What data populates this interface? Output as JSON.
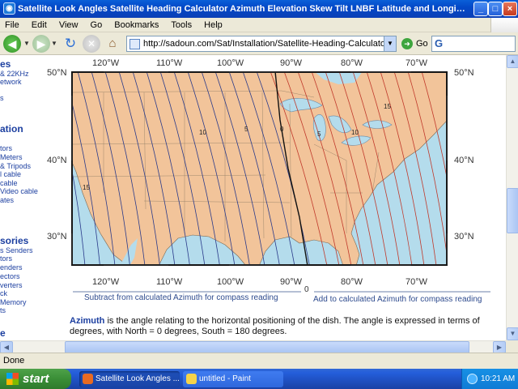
{
  "window": {
    "title": "Satellite Look Angles Satellite Heading Calculator Azimuth Elevation Skew Tilt LNBF Latitude and Longitude valu...",
    "buttons": {
      "minimize": "_",
      "maximize": "□",
      "close": "×"
    }
  },
  "menu": [
    "File",
    "Edit",
    "View",
    "Go",
    "Bookmarks",
    "Tools",
    "Help"
  ],
  "toolbar": {
    "address": "http://sadoun.com/Sat/Installation/Satellite-Heading-Calculator.htm",
    "go_label": "Go",
    "search_logo": "G"
  },
  "sidebar": [
    {
      "text": "es",
      "heading": true
    },
    {
      "text": "& 22KHz",
      "heading": false
    },
    {
      "text": "etwork",
      "heading": false
    },
    {
      "text": "s",
      "heading": false
    },
    {
      "text": "ation",
      "heading": true
    },
    {
      "text": "tors",
      "heading": false
    },
    {
      "text": "Meters",
      "heading": false
    },
    {
      "text": "& Tripods",
      "heading": false
    },
    {
      "text": "l cable",
      "heading": false
    },
    {
      "text": "cable",
      "heading": false
    },
    {
      "text": "Video cable",
      "heading": false
    },
    {
      "text": "ates",
      "heading": false
    },
    {
      "text": "sories",
      "heading": true
    },
    {
      "text": "s Senders",
      "heading": false
    },
    {
      "text": "tors",
      "heading": false
    },
    {
      "text": "enders",
      "heading": false
    },
    {
      "text": "ectors",
      "heading": false
    },
    {
      "text": "verters",
      "heading": false
    },
    {
      "text": "ck",
      "heading": false
    },
    {
      "text": "Memory",
      "heading": false
    },
    {
      "text": "ts",
      "heading": false
    },
    {
      "text": "e",
      "heading": true
    }
  ],
  "map": {
    "lon_labels": [
      "120°W",
      "110°W",
      "100°W",
      "90°W",
      "80°W",
      "70°W"
    ],
    "lat_labels": [
      "50°N",
      "40°N",
      "30°N"
    ],
    "contour_labels": [
      "15",
      "10",
      "5",
      "0",
      "5",
      "10",
      "15"
    ],
    "zero_label": "0",
    "caption_left": "Subtract from calculated Azimuth for compass reading",
    "caption_right": "Add to calculated Azimuth for compass reading",
    "colors": {
      "land": "#f2c49a",
      "water": "#b4dcec",
      "west_lines": "#2a3a8a",
      "east_lines": "#c0392b"
    }
  },
  "paragraph": {
    "term": "Azimuth",
    "text": " is the angle relating to the horizontal positioning of the dish. The angle is expressed in terms of degrees, with North = 0 degrees, South = 180 degrees."
  },
  "status": "Done",
  "taskbar": {
    "start": "start",
    "tasks": [
      "Satellite Look Angles ...",
      "untitled - Paint"
    ],
    "clock": "10:21 AM"
  }
}
